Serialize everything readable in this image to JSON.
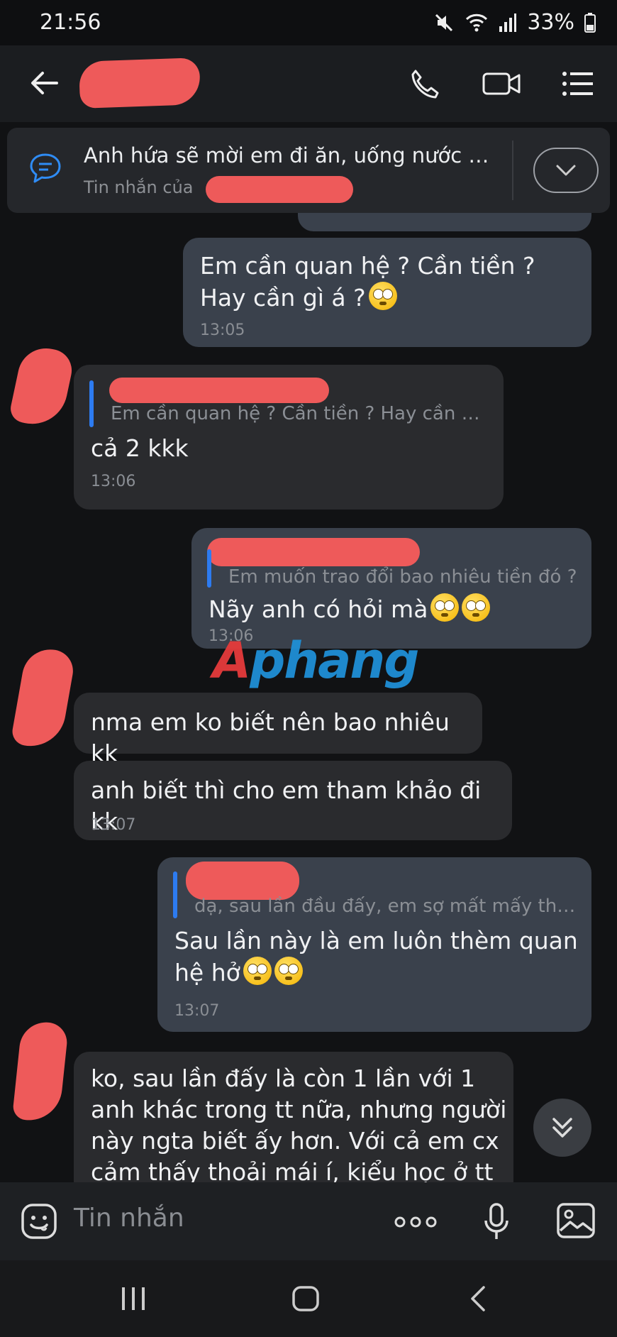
{
  "status_bar": {
    "time": "21:56",
    "battery": "33%"
  },
  "pinned": {
    "text": "Anh hứa sẽ mời em đi ăn, uống nước v...",
    "sub_label": "Tin nhắn của"
  },
  "messages": {
    "m1": {
      "text": "Em cần quan hệ ? Cần tiền ? Hay cần gì á ?",
      "time": "13:05"
    },
    "m2": {
      "quote": "Em cần quan hệ ? Cần tiền ? Hay cần gì...",
      "text": "cả 2 kkk",
      "time": "13:06"
    },
    "m3": {
      "quote": "Em muốn trao đổi bao nhiêu tiền đó ?",
      "text": "Nãy anh có hỏi mà",
      "time": "13:06"
    },
    "m4": {
      "text": "nma em ko biết nên bao nhiêu kk"
    },
    "m5": {
      "text": "anh biết thì cho em tham khảo đi kk",
      "time": "13:07"
    },
    "m6": {
      "quote": "dạ, sau lần đầu đấy, em sợ mất mấy thá...",
      "text_line1": "Sau lần này là em luôn thèm quan",
      "text_line2": "hệ hở",
      "time": "13:07"
    },
    "m7": {
      "line1": "ko, sau lần đấy là còn 1 lần với 1",
      "line2": "anh khác trong tt nữa, nhưng người",
      "line3": "này ngta biết ấy hơn. Với cả em cx",
      "line4": "cảm thấy thoải mái í, kiểu học ở tt"
    }
  },
  "watermark": {
    "a": "A",
    "rest": "phang"
  },
  "composer": {
    "placeholder": "Tin nhắn"
  },
  "colors": {
    "redaction": "#ee5a5a",
    "outgoing_bubble": "#3a414c",
    "incoming_bubble": "#2a2b2e",
    "quote_bar": "#2d7bf0"
  }
}
